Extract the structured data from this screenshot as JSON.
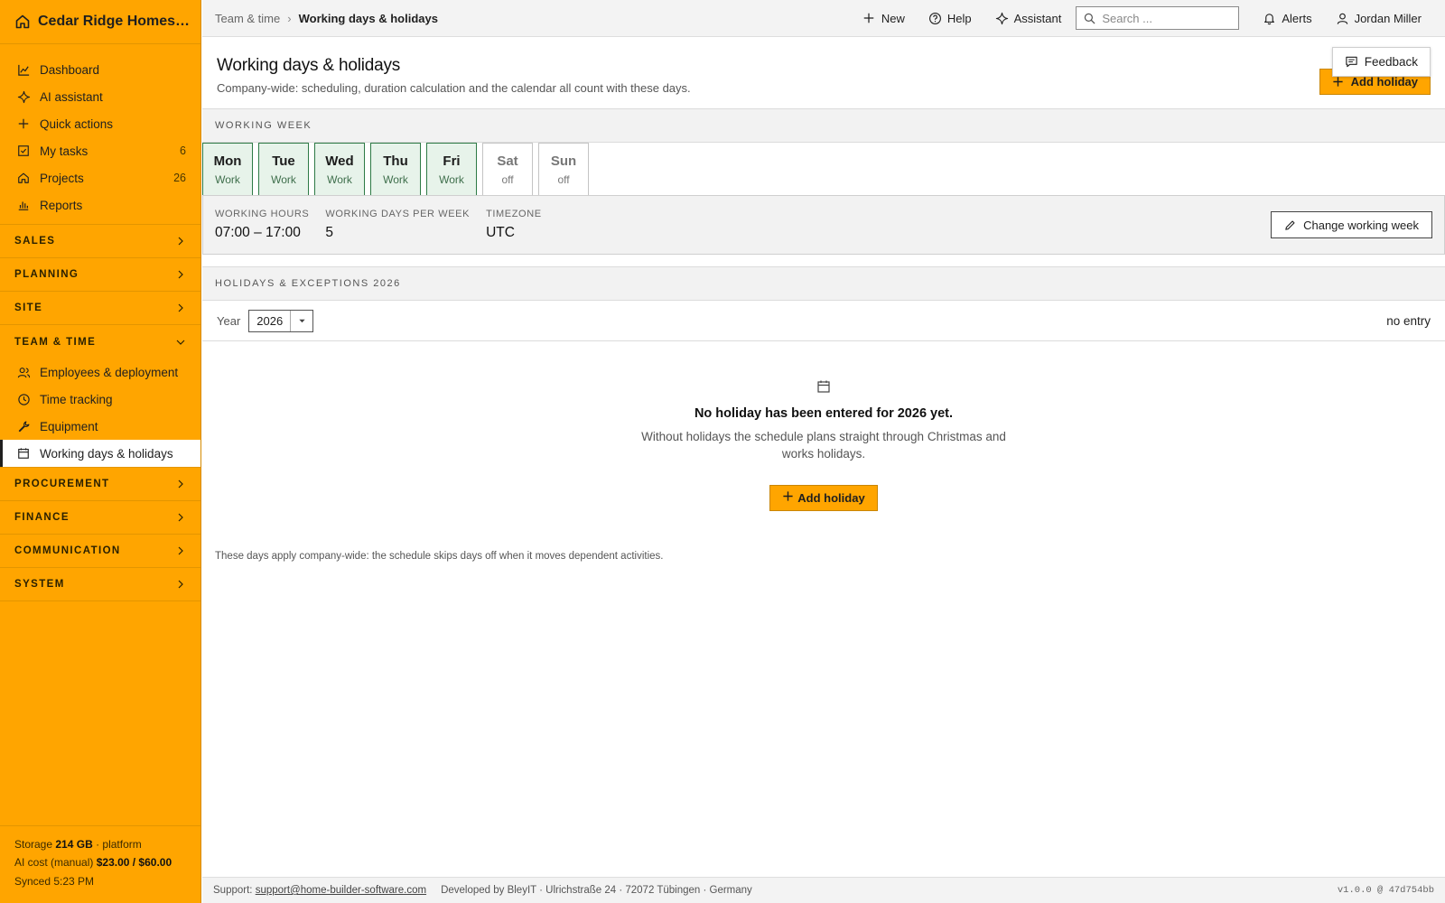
{
  "app": {
    "name": "Cedar Ridge Homes L..."
  },
  "sidebar": {
    "main_items": [
      {
        "label": "Dashboard",
        "icon": "chart-line-icon"
      },
      {
        "label": "AI assistant",
        "icon": "sparkle-icon"
      },
      {
        "label": "Quick actions",
        "icon": "plus-icon"
      },
      {
        "label": "My tasks",
        "icon": "checkbox-icon",
        "count": "6"
      },
      {
        "label": "Projects",
        "icon": "house-icon",
        "count": "26"
      },
      {
        "label": "Reports",
        "icon": "bar-chart-icon"
      }
    ],
    "sections": {
      "sales": "SALES",
      "planning": "PLANNING",
      "site": "SITE",
      "team_time": "TEAM & TIME",
      "procurement": "PROCUREMENT",
      "finance": "FINANCE",
      "communication": "COMMUNICATION",
      "system": "SYSTEM"
    },
    "team_items": [
      {
        "label": "Employees & deployment",
        "icon": "people-icon"
      },
      {
        "label": "Time tracking",
        "icon": "clock-icon"
      },
      {
        "label": "Equipment",
        "icon": "wrench-icon"
      },
      {
        "label": "Working days & holidays",
        "icon": "calendar-icon",
        "active": true
      }
    ],
    "footer": {
      "storage_label": "Storage",
      "storage_value": "214 GB",
      "storage_suffix": "· platform",
      "ai_label": "AI cost (manual)",
      "ai_value": "$23.00 / $60.00",
      "synced": "Synced 5:23 PM"
    }
  },
  "topbar": {
    "breadcrumb_parent": "Team & time",
    "breadcrumb_sep": "›",
    "breadcrumb_current": "Working days & holidays",
    "new_label": "New",
    "help_label": "Help",
    "assistant_label": "Assistant",
    "search_placeholder": "Search ...",
    "alerts_label": "Alerts",
    "user_name": "Jordan Miller"
  },
  "page": {
    "title": "Working days & holidays",
    "subtitle": "Company-wide: scheduling, duration calculation and the calendar all count with these days.",
    "add_holiday_label": "Add holiday",
    "feedback_label": "Feedback"
  },
  "working_week": {
    "heading": "WORKING WEEK",
    "days": [
      {
        "name": "Mon",
        "status": "Work"
      },
      {
        "name": "Tue",
        "status": "Work"
      },
      {
        "name": "Wed",
        "status": "Work"
      },
      {
        "name": "Thu",
        "status": "Work"
      },
      {
        "name": "Fri",
        "status": "Work"
      },
      {
        "name": "Sat",
        "status": "off"
      },
      {
        "name": "Sun",
        "status": "off"
      }
    ],
    "hours_label": "WORKING HOURS",
    "hours_value": "07:00 – 17:00",
    "days_label": "WORKING DAYS PER WEEK",
    "days_value": "5",
    "tz_label": "TIMEZONE",
    "tz_value": "UTC",
    "change_label": "Change working week"
  },
  "holidays": {
    "heading": "HOLIDAYS & EXCEPTIONS 2026",
    "year_label": "Year",
    "year_value": "2026",
    "entry_count": "no entry",
    "empty_title": "No holiday has been entered for 2026 yet.",
    "empty_desc": "Without holidays the schedule plans straight through Christmas and works holidays.",
    "add_label": "Add holiday",
    "note": "These days apply company-wide: the schedule skips days off when it moves dependent activities."
  },
  "footer": {
    "support_label": "Support:",
    "support_email": "support@home-builder-software.com",
    "developer": "Developed by BleyIT · Ulrichstraße 24 · 72072 Tübingen · Germany",
    "version": "v1.0.0 @ 47d754bb"
  },
  "colors": {
    "accent": "#ffa500",
    "work_day_bg": "#e7f3ea",
    "work_day_border": "#2d7a45"
  }
}
